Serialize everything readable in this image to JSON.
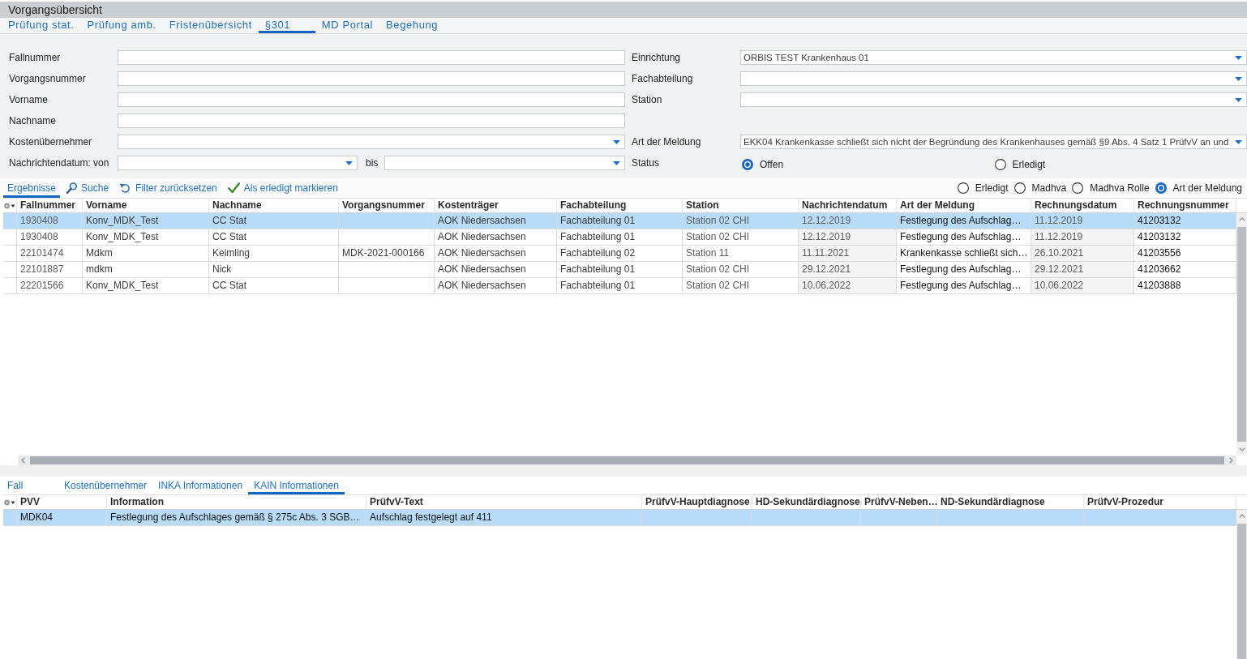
{
  "window": {
    "title": "Vorgangsübersicht"
  },
  "tabs": [
    {
      "label": "Prüfung stat.",
      "selected": false
    },
    {
      "label": "Prüfung amb.",
      "selected": false
    },
    {
      "label": "Fristenübersicht",
      "selected": false
    },
    {
      "label": "§301",
      "selected": true
    },
    {
      "label": "MD Portal",
      "selected": false
    },
    {
      "label": "Begehung",
      "selected": false
    }
  ],
  "filters": {
    "rows": [
      {
        "left": {
          "label": "Fallnummer",
          "kind": "text"
        },
        "right": {
          "label": "Einrichtung",
          "kind": "dropdown",
          "value": "ORBIS TEST Krankenhaus 01"
        }
      },
      {
        "left": {
          "label": "Vorgangsnummer",
          "kind": "text"
        },
        "right": {
          "label": "Fachabteilung",
          "kind": "dropdown"
        }
      },
      {
        "left": {
          "label": "Vorname",
          "kind": "text"
        },
        "right": {
          "label": "Station",
          "kind": "dropdown"
        }
      },
      {
        "left": {
          "label": "Nachname",
          "kind": "text"
        }
      },
      {
        "left": {
          "label": "Kostenübernehmer",
          "kind": "dropdown"
        },
        "right": {
          "label": "Art der Meldung",
          "kind": "dropdown",
          "value": "EKK04 Krankenkasse schließt sich nicht der Begründung des Krankenhauses gemäß §9 Abs. 4 Satz 1 PrüfvV an und"
        }
      },
      {
        "left": {
          "label": "Nachrichtendatum: von",
          "kind": "date_range",
          "to_label": "bis"
        },
        "right": {
          "label": "Status",
          "kind": "radio",
          "options": [
            {
              "label": "Offen",
              "selected": true
            },
            {
              "label": "Erledigt",
              "selected": false
            }
          ]
        }
      }
    ]
  },
  "results_toolbar": {
    "tabs": [
      {
        "label": "Ergebnisse",
        "selected": true
      }
    ],
    "actions": [
      {
        "kind": "search",
        "label": "Suche"
      },
      {
        "kind": "reset",
        "label": "Filter zurücksetzen"
      },
      {
        "kind": "mark_done",
        "label": "Als erledigt markieren"
      }
    ],
    "view_options": [
      {
        "label": "Erledigt",
        "selected": false
      },
      {
        "label": "Madhva",
        "selected": false
      },
      {
        "label": "Madhva Rolle",
        "selected": false
      },
      {
        "label": "Art der Meldung",
        "selected": true
      }
    ]
  },
  "results_table": {
    "columns": [
      "Fallnummer",
      "Vorname",
      "Nachname",
      "Vorgangsnummer",
      "Kostenträger",
      "Fachabteilung",
      "Station",
      "Nachrichtendatum",
      "Art der Meldung",
      "Rechnungsdatum",
      "Rechnungsnummer"
    ],
    "rows": [
      {
        "selected": true,
        "cells": [
          "1930408",
          "Konv_MDK_Test",
          "CC Stat",
          null,
          "AOK Niedersachsen",
          "Fachabteilung 01",
          "Station 02 CHI",
          "12.12.2019",
          "Festlegung des Aufschlag…",
          "11.12.2019",
          "41203132"
        ]
      },
      {
        "selected": false,
        "cells": [
          "1930408",
          "Konv_MDK_Test",
          "CC Stat",
          null,
          "AOK Niedersachsen",
          "Fachabteilung 01",
          "Station 02 CHI",
          "12.12.2019",
          "Festlegung des Aufschlag…",
          "11.12.2019",
          "41203132"
        ]
      },
      {
        "selected": false,
        "cells": [
          "22101474",
          "Mdkm",
          "Keimling",
          "MDK-2021-000166",
          "AOK Niedersachsen",
          "Fachabteilung 02",
          "Station 11",
          "11.11.2021",
          "Krankenkasse schließt sich…",
          "26.10.2021",
          "41203556"
        ]
      },
      {
        "selected": false,
        "cells": [
          "22101887",
          "mdkm",
          "Nick",
          null,
          "AOK Niedersachsen",
          "Fachabteilung 01",
          "Station 02 CHI",
          "29.12.2021",
          "Festlegung des Aufschlag…",
          "29.12.2021",
          "41203662"
        ]
      },
      {
        "selected": false,
        "cells": [
          "22201566",
          "Konv_MDK_Test",
          "CC Stat",
          null,
          "AOK Niedersachsen",
          "Fachabteilung 01",
          "Station 02 CHI",
          "10.06.2022",
          "Festlegung des Aufschlag…",
          "10.06.2022",
          "41203888"
        ]
      }
    ]
  },
  "detail_tabs": [
    {
      "label": "Fall",
      "selected": false
    },
    {
      "label": "Kostenübernehmer",
      "selected": false
    },
    {
      "label": "INKA Informationen",
      "selected": false
    },
    {
      "label": "KAIN Informationen",
      "selected": true
    }
  ],
  "detail_table": {
    "columns": [
      "PVV",
      "Information",
      "PrüfvV-Text",
      "PrüfvV-Hauptdiagnose",
      "HD-Sekundärdiagnose",
      "PrüfvV-Neben…",
      "ND-Sekundärdiagnose",
      "PrüfvV-Prozedur"
    ],
    "rows": [
      {
        "selected": true,
        "cells": [
          "MDK04",
          "Festlegung des Aufschlages gemäß § 275c Abs. 3 SGB…",
          "Aufschlag festgelegt auf 411",
          null,
          null,
          null,
          null,
          null
        ]
      }
    ]
  }
}
